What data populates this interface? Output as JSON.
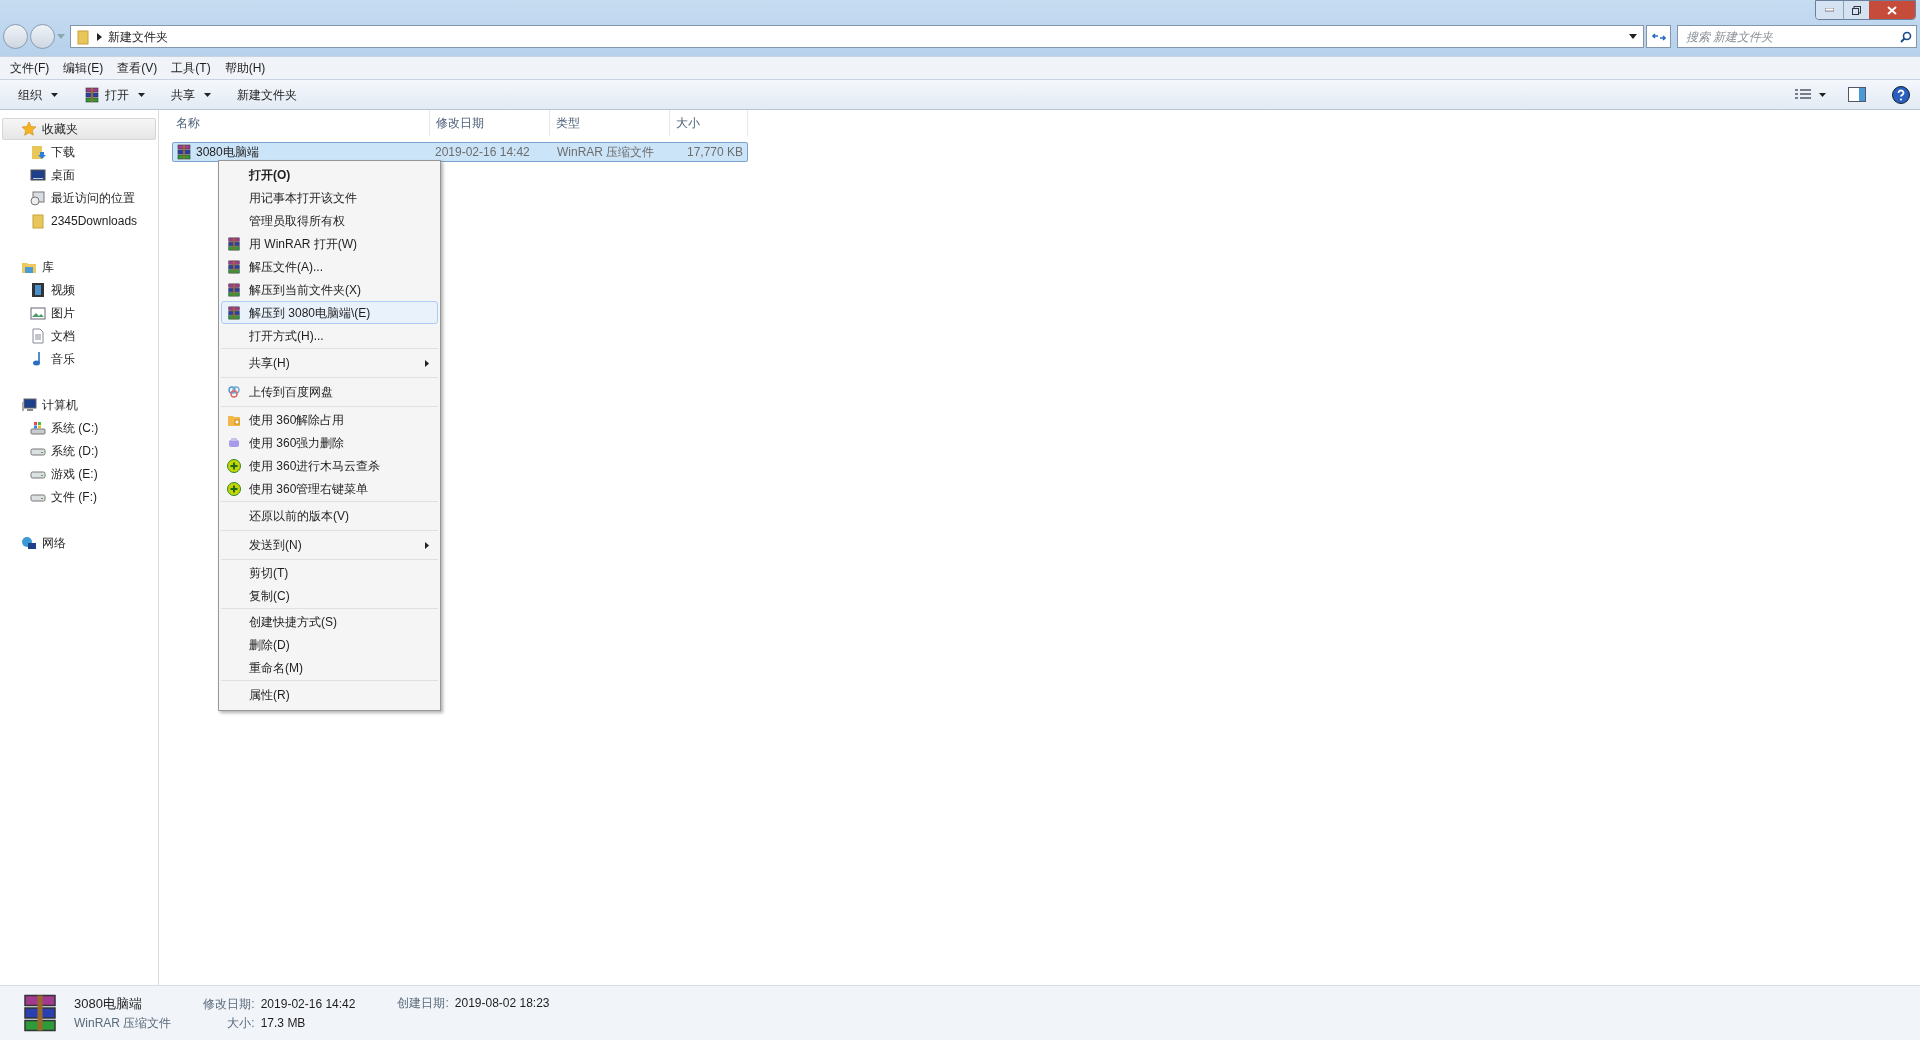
{
  "address_bar": {
    "path": "新建文件夹",
    "search_placeholder": "搜索 新建文件夹"
  },
  "menu_bar": [
    "文件(F)",
    "编辑(E)",
    "查看(V)",
    "工具(T)",
    "帮助(H)"
  ],
  "toolbar": [
    {
      "label": "组织",
      "kind": "dropdown"
    },
    {
      "label": "打开",
      "kind": "winrar-dropdown"
    },
    {
      "label": "共享",
      "kind": "dropdown"
    },
    {
      "label": "新建文件夹",
      "kind": "plain"
    }
  ],
  "sidebar": [
    {
      "label": "收藏夹",
      "kind": "star",
      "selected": true,
      "children": [
        {
          "label": "下载",
          "kind": "download",
          "selected": false
        },
        {
          "label": "桌面",
          "kind": "desktop",
          "selected": false
        },
        {
          "label": "最近访问的位置",
          "kind": "recent",
          "selected": false
        },
        {
          "label": "2345Downloads",
          "kind": "folder",
          "selected": false
        }
      ]
    },
    {
      "label": "库",
      "kind": "library",
      "selected": false,
      "children": [
        {
          "label": "视频",
          "kind": "video",
          "selected": false
        },
        {
          "label": "图片",
          "kind": "picture",
          "selected": false
        },
        {
          "label": "文档",
          "kind": "document",
          "selected": false
        },
        {
          "label": "音乐",
          "kind": "music",
          "selected": false
        }
      ]
    },
    {
      "label": "计算机",
      "kind": "computer",
      "selected": false,
      "children": [
        {
          "label": "系统 (C:)",
          "kind": "sysdrive",
          "selected": false
        },
        {
          "label": "系统 (D:)",
          "kind": "drive",
          "selected": false
        },
        {
          "label": "游戏 (E:)",
          "kind": "drive",
          "selected": false
        },
        {
          "label": "文件 (F:)",
          "kind": "drive",
          "selected": false
        }
      ]
    },
    {
      "label": "网络",
      "kind": "network",
      "selected": false
    }
  ],
  "table": {
    "columns": [
      "名称",
      "修改日期",
      "类型",
      "大小"
    ],
    "rows": [
      {
        "name": "3080电脑端",
        "modified": "2019-02-16 14:42",
        "type": "WinRAR 压缩文件",
        "size": "17,770 KB",
        "selected": true
      }
    ]
  },
  "context_menu": [
    [
      {
        "label": "打开(O)",
        "default": true,
        "kind": "plain",
        "submenu": false,
        "selected": false
      },
      {
        "label": "用记事本打开该文件",
        "default": false,
        "kind": "plain",
        "submenu": false,
        "selected": false
      },
      {
        "label": "管理员取得所有权",
        "default": false,
        "kind": "plain",
        "submenu": false,
        "selected": false
      },
      {
        "label": "用 WinRAR 打开(W)",
        "default": false,
        "kind": "winrar",
        "submenu": false,
        "selected": false
      },
      {
        "label": "解压文件(A)...",
        "default": false,
        "kind": "winrar",
        "submenu": false,
        "selected": false
      },
      {
        "label": "解压到当前文件夹(X)",
        "default": false,
        "kind": "winrar",
        "submenu": false,
        "selected": false
      },
      {
        "label": "解压到 3080电脑端\\(E)",
        "default": false,
        "kind": "winrar",
        "submenu": false,
        "selected": true
      },
      {
        "label": "打开方式(H)...",
        "default": false,
        "kind": "plain",
        "submenu": false,
        "selected": false
      }
    ],
    [
      {
        "label": "共享(H)",
        "default": false,
        "kind": "plain",
        "submenu": true,
        "selected": false
      }
    ],
    [
      {
        "label": "上传到百度网盘",
        "default": false,
        "kind": "cloud",
        "submenu": false,
        "selected": false
      }
    ],
    [
      {
        "label": "使用 360解除占用",
        "default": false,
        "kind": "folder-lock",
        "submenu": false,
        "selected": false
      },
      {
        "label": "使用 360强力删除",
        "default": false,
        "kind": "shredder",
        "submenu": false,
        "selected": false
      },
      {
        "label": "使用 360进行木马云查杀",
        "default": false,
        "kind": "plus-circle",
        "submenu": false,
        "selected": false
      },
      {
        "label": "使用 360管理右键菜单",
        "default": false,
        "kind": "plus-circle",
        "submenu": false,
        "selected": false
      }
    ],
    [
      {
        "label": "还原以前的版本(V)",
        "default": false,
        "kind": "plain",
        "submenu": false,
        "selected": false
      }
    ],
    [
      {
        "label": "发送到(N)",
        "default": false,
        "kind": "plain",
        "submenu": true,
        "selected": false
      }
    ],
    [
      {
        "label": "剪切(T)",
        "default": false,
        "kind": "plain",
        "submenu": false,
        "selected": false
      },
      {
        "label": "复制(C)",
        "default": false,
        "kind": "plain",
        "submenu": false,
        "selected": false
      }
    ],
    [
      {
        "label": "创建快捷方式(S)",
        "default": false,
        "kind": "plain",
        "submenu": false,
        "selected": false
      },
      {
        "label": "删除(D)",
        "default": false,
        "kind": "plain",
        "submenu": false,
        "selected": false
      },
      {
        "label": "重命名(M)",
        "default": false,
        "kind": "plain",
        "submenu": false,
        "selected": false
      }
    ],
    [
      {
        "label": "属性(R)",
        "default": false,
        "kind": "plain",
        "submenu": false,
        "selected": false
      }
    ]
  ],
  "details_pane": {
    "name": "3080电脑端",
    "type": "WinRAR 压缩文件",
    "modified_label": "修改日期:",
    "modified": "2019-02-16 14:42",
    "size_label": "大小:",
    "size": "17.3 MB",
    "created_label": "创建日期:",
    "created": "2019-08-02 18:23"
  }
}
